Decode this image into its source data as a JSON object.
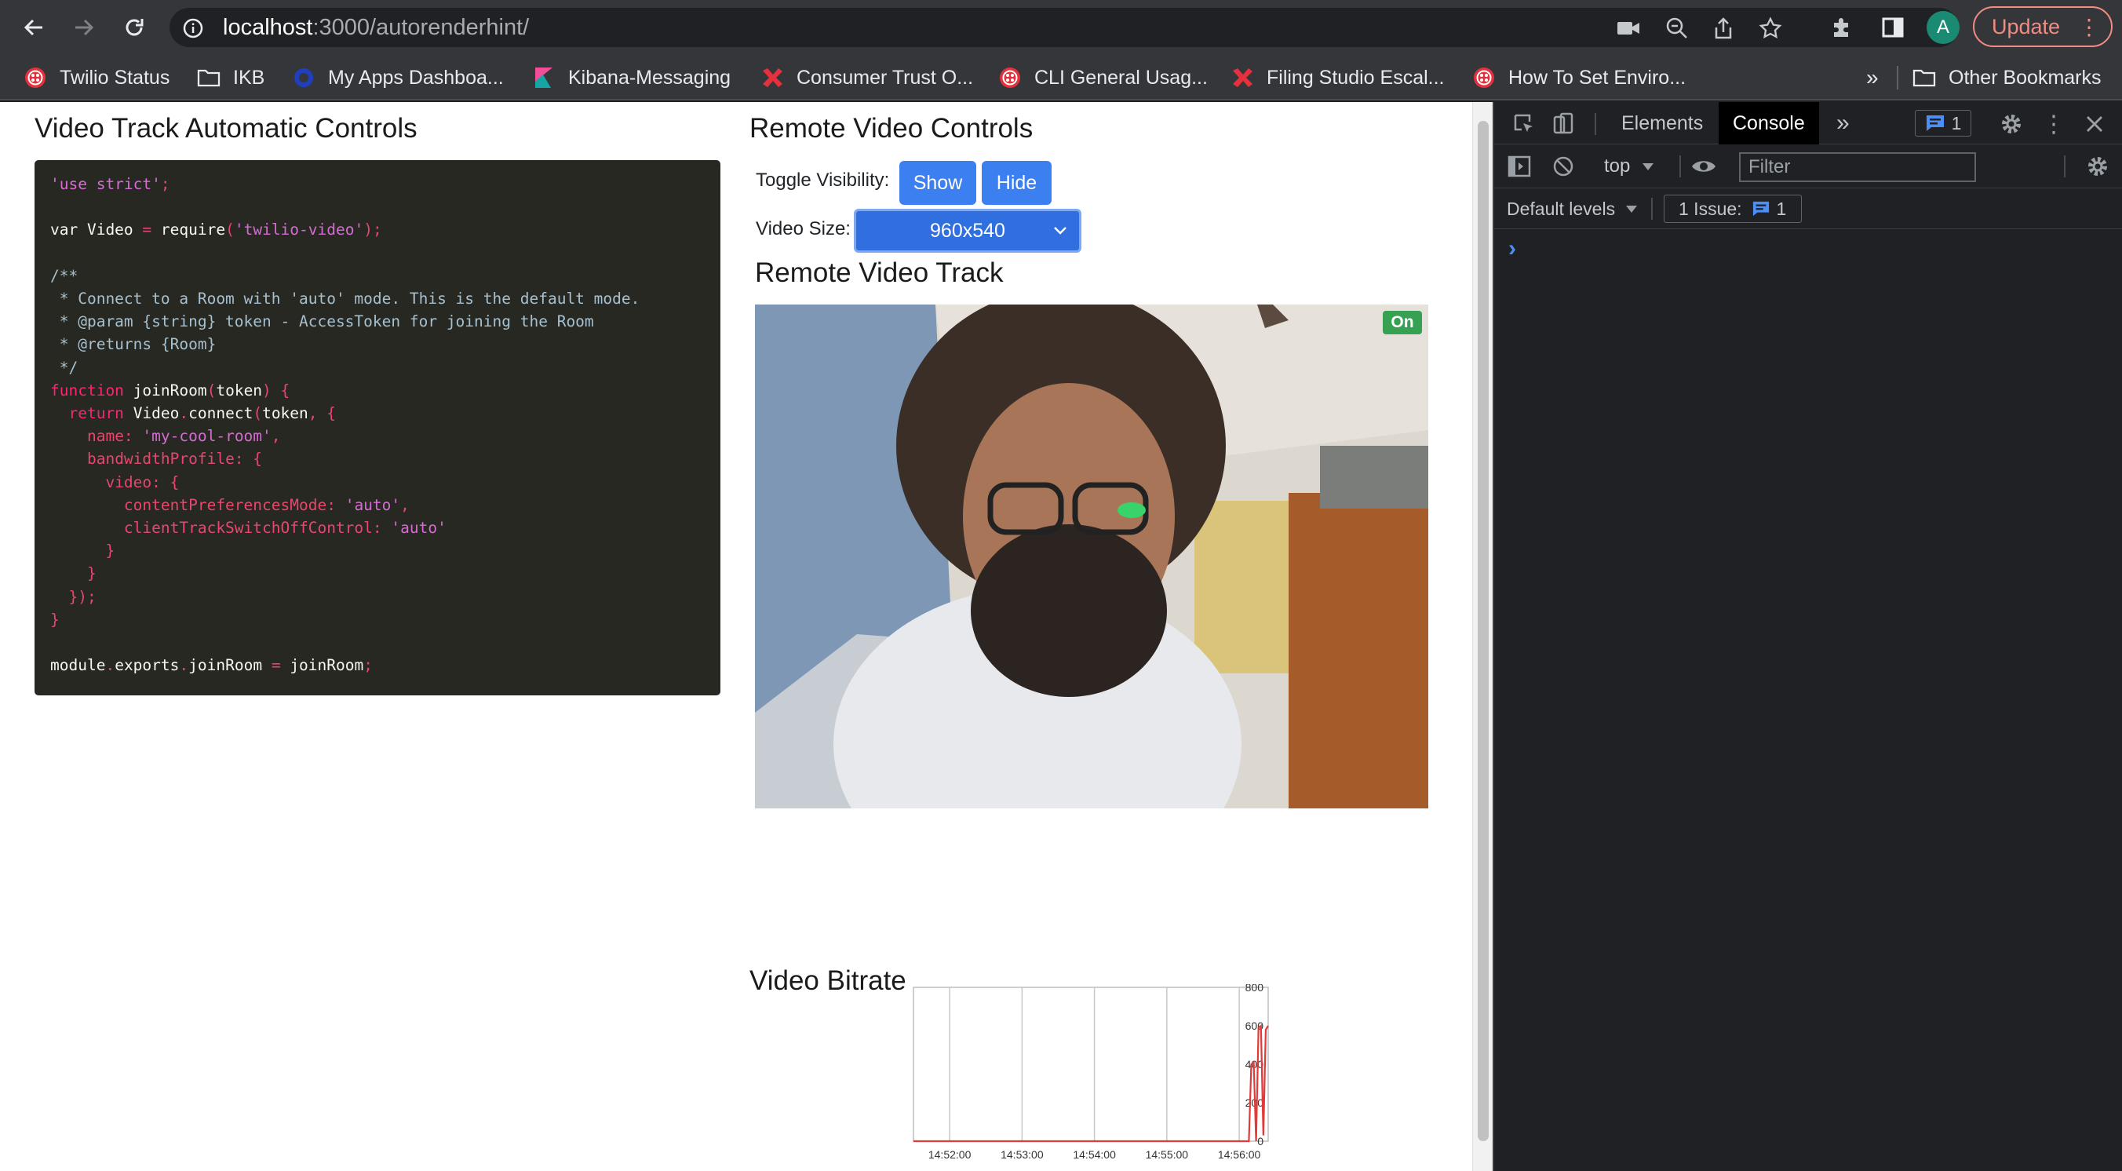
{
  "browser": {
    "url_host": "localhost",
    "url_rest": ":3000/autorenderhint/",
    "avatar_letter": "A",
    "update_label": "Update",
    "bookmarks": [
      {
        "label": "Twilio Status",
        "icon": "twilio-icon"
      },
      {
        "label": "IKB",
        "icon": "folder-icon"
      },
      {
        "label": "My Apps Dashboa...",
        "icon": "okta-icon"
      },
      {
        "label": "Kibana-Messaging",
        "icon": "kibana-icon"
      },
      {
        "label": "Consumer Trust O...",
        "icon": "wrench-icon"
      },
      {
        "label": "CLI General Usag...",
        "icon": "twilio-icon"
      },
      {
        "label": "Filing Studio Escal...",
        "icon": "wrench-icon"
      },
      {
        "label": "How To Set Enviro...",
        "icon": "twilio-icon"
      }
    ],
    "more_bookmarks": "»",
    "other_bookmarks": "Other Bookmarks"
  },
  "left": {
    "title": "Video Track Automatic Controls"
  },
  "right": {
    "controls_title": "Remote Video Controls",
    "toggle_label": "Toggle Visibility:",
    "show_label": "Show",
    "hide_label": "Hide",
    "size_label": "Video Size:",
    "size_value": "960x540",
    "track_title": "Remote Video Track",
    "on_badge": "On",
    "bitrate_title": "Video Bitrate"
  },
  "chart_data": {
    "type": "line",
    "title": "",
    "x_ticks": [
      "14:52:00",
      "14:53:00",
      "14:54:00",
      "14:55:00",
      "14:56:00"
    ],
    "y_ticks": [
      "800",
      "600",
      "400",
      "200",
      "0"
    ],
    "ylim": [
      0,
      800
    ],
    "grid": true,
    "series": [
      {
        "color": "#e03a3a",
        "x": [
          "14:51:30",
          "14:52:00",
          "14:53:00",
          "14:54:00",
          "14:55:00",
          "14:56:00",
          "14:56:08",
          "14:56:10",
          "14:56:12",
          "14:56:14",
          "14:56:16",
          "14:56:18",
          "14:56:20",
          "14:56:22",
          "14:56:24"
        ],
        "values": [
          0,
          0,
          0,
          0,
          0,
          0,
          0,
          400,
          410,
          0,
          590,
          600,
          30,
          580,
          600
        ]
      }
    ]
  },
  "devtools": {
    "tab_elements": "Elements",
    "tab_console": "Console",
    "issues_badge": "1",
    "context": "top",
    "filter_placeholder": "Filter",
    "levels": "Default levels",
    "issue_label": "1 Issue:",
    "issue_count": "1",
    "prompt": "›"
  }
}
